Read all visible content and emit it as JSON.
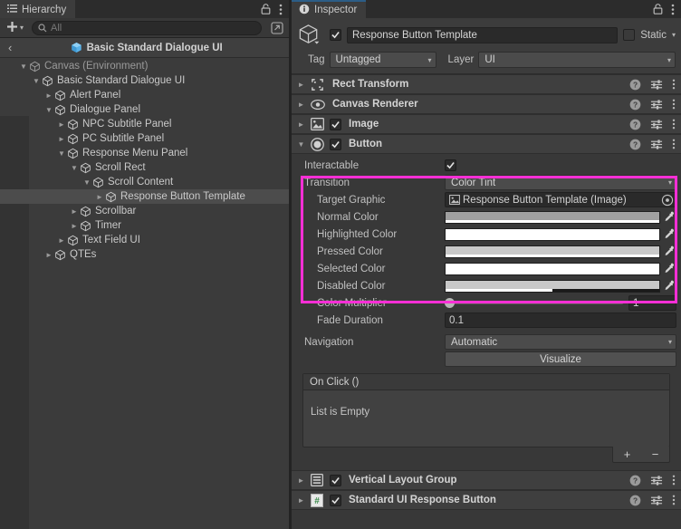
{
  "hierarchy": {
    "tab_label": "Hierarchy",
    "tab_icon": "hierarchy-list-icon",
    "lock_icon": "lock-icon",
    "menu_icon": "kebab-menu-icon",
    "create_label": "+",
    "search_placeholder": "All",
    "search_value": "",
    "search_icon": "search-icon",
    "expand_icon": "open-in-new-icon",
    "breadcrumb_back": "‹",
    "breadcrumb_label": "Basic Standard Dialogue UI",
    "breadcrumb_icon": "prefab-cube-icon",
    "items": [
      {
        "label": "Canvas (Environment)",
        "depth": 1,
        "twisty": "down",
        "selected": false,
        "dim": true
      },
      {
        "label": "Basic Standard Dialogue UI",
        "depth": 2,
        "twisty": "down",
        "selected": false,
        "dim": false
      },
      {
        "label": "Alert Panel",
        "depth": 3,
        "twisty": "right",
        "selected": false,
        "dim": false
      },
      {
        "label": "Dialogue Panel",
        "depth": 3,
        "twisty": "down",
        "selected": false,
        "dim": false
      },
      {
        "label": "NPC Subtitle Panel",
        "depth": 4,
        "twisty": "right",
        "selected": false,
        "dim": false
      },
      {
        "label": "PC Subtitle Panel",
        "depth": 4,
        "twisty": "right",
        "selected": false,
        "dim": false
      },
      {
        "label": "Response Menu Panel",
        "depth": 4,
        "twisty": "down",
        "selected": false,
        "dim": false
      },
      {
        "label": "Scroll Rect",
        "depth": 5,
        "twisty": "down",
        "selected": false,
        "dim": false
      },
      {
        "label": "Scroll Content",
        "depth": 6,
        "twisty": "down",
        "selected": false,
        "dim": false
      },
      {
        "label": "Response Button Template",
        "depth": 7,
        "twisty": "right",
        "selected": true,
        "dim": false
      },
      {
        "label": "Scrollbar",
        "depth": 5,
        "twisty": "right",
        "selected": false,
        "dim": false
      },
      {
        "label": "Timer",
        "depth": 5,
        "twisty": "right",
        "selected": false,
        "dim": false
      },
      {
        "label": "Text Field UI",
        "depth": 4,
        "twisty": "right",
        "selected": false,
        "dim": false
      },
      {
        "label": "QTEs",
        "depth": 3,
        "twisty": "right",
        "selected": false,
        "dim": false
      }
    ]
  },
  "inspector": {
    "tab_label": "Inspector",
    "tab_icon": "info-circle-icon",
    "lock_icon": "lock-icon",
    "menu_icon": "kebab-menu-icon",
    "object_icon": "gameobject-cube-icon",
    "enabled_checked": true,
    "name_value": "Response Button Template",
    "static_label": "Static",
    "static_checked": false,
    "tag_label": "Tag",
    "tag_value": "Untagged",
    "layer_label": "Layer",
    "layer_value": "UI",
    "components": [
      {
        "title": "Rect Transform",
        "icon": "rect-transform-icon",
        "expanded": false,
        "has_checkbox": false,
        "checked": false
      },
      {
        "title": "Canvas Renderer",
        "icon": "eye-icon",
        "expanded": false,
        "has_checkbox": false,
        "checked": false
      },
      {
        "title": "Image",
        "icon": "image-icon",
        "expanded": false,
        "has_checkbox": true,
        "checked": true
      },
      {
        "title": "Button",
        "icon": "button-circle-icon",
        "expanded": true,
        "has_checkbox": true,
        "checked": true
      }
    ],
    "components_bottom": [
      {
        "title": "Vertical Layout Group",
        "icon": "vertical-layout-icon",
        "expanded": false,
        "has_checkbox": true,
        "checked": true
      },
      {
        "title": "Standard UI Response Button",
        "icon": "csharp-script-icon",
        "expanded": false,
        "has_checkbox": true,
        "checked": true
      }
    ],
    "help_icon": "help-icon",
    "preset_icon": "preset-sliders-icon",
    "kebab_icon": "kebab-menu-icon",
    "button_component": {
      "interactable_label": "Interactable",
      "interactable_checked": true,
      "transition_label": "Transition",
      "transition_value": "Color Tint",
      "target_graphic_label": "Target Graphic",
      "target_graphic_value": "Response Button Template (Image)",
      "target_graphic_icon": "image-icon",
      "target_graphic_picker_icon": "object-picker-icon",
      "eyedropper_icon": "eyedropper-icon",
      "colors": [
        {
          "label": "Normal Color",
          "hex": "#a0a0a0",
          "alpha_pct": 100
        },
        {
          "label": "Highlighted Color",
          "hex": "#ffffff",
          "alpha_pct": 100
        },
        {
          "label": "Pressed Color",
          "hex": "#c8c8c8",
          "alpha_pct": 100
        },
        {
          "label": "Selected Color",
          "hex": "#ffffff",
          "alpha_pct": 100
        },
        {
          "label": "Disabled Color",
          "hex": "#c8c8c8",
          "alpha_pct": 50
        }
      ],
      "color_multiplier_label": "Color Multiplier",
      "color_multiplier_value": "1",
      "fade_duration_label": "Fade Duration",
      "fade_duration_value": "0.1",
      "navigation_label": "Navigation",
      "navigation_value": "Automatic",
      "visualize_label": "Visualize",
      "onclick_title": "On Click ()",
      "onclick_empty": "List is Empty",
      "add_label": "+",
      "remove_label": "−"
    }
  },
  "highlight": {
    "name": "magenta-annotation-box",
    "color": "#ff2fd6"
  }
}
